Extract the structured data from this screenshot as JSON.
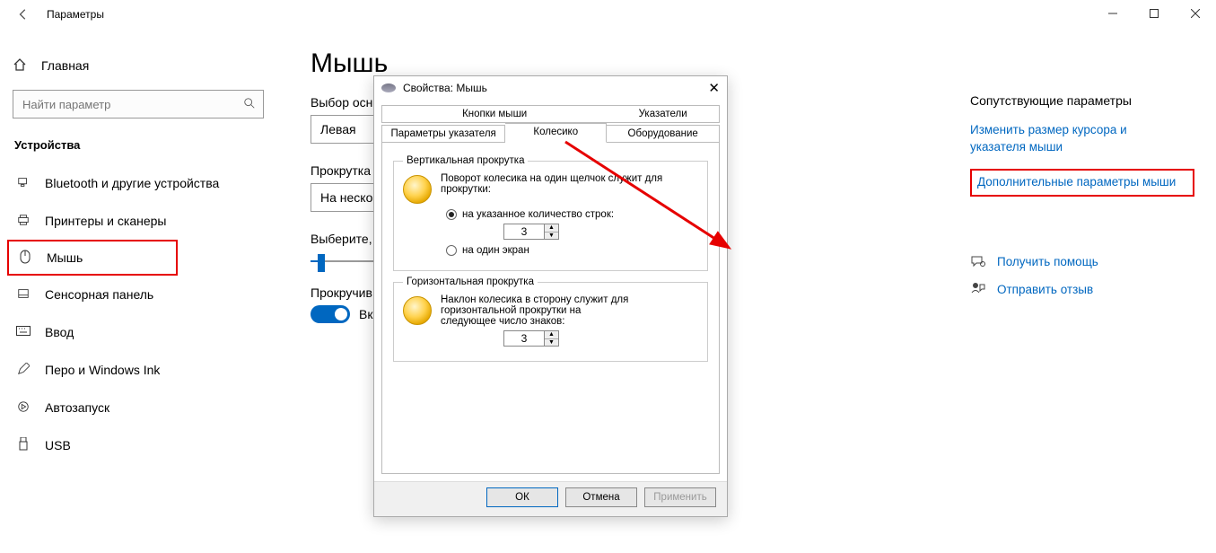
{
  "titlebar": {
    "title": "Параметры"
  },
  "sidebar": {
    "home": "Главная",
    "search_placeholder": "Найти параметр",
    "group": "Устройства",
    "items": [
      {
        "label": "Bluetooth и другие устройства"
      },
      {
        "label": "Принтеры и сканеры"
      },
      {
        "label": "Мышь"
      },
      {
        "label": "Сенсорная панель"
      },
      {
        "label": "Ввод"
      },
      {
        "label": "Перо и Windows Ink"
      },
      {
        "label": "Автозапуск"
      },
      {
        "label": "USB"
      }
    ]
  },
  "main": {
    "heading": "Мышь",
    "primary_button_label": "Выбор осн",
    "primary_button_value": "Левая",
    "scroll_label": "Прокрутка",
    "scroll_value": "На неско",
    "choose_label": "Выберите,",
    "inactive_label": "Прокручив",
    "inactive_toggle_text": "Вк"
  },
  "related": {
    "heading": "Сопутствующие параметры",
    "link1a": "Изменить размер курсора и",
    "link1b": "указателя мыши",
    "link2": "Дополнительные параметры мыши",
    "help": "Получить помощь",
    "feedback": "Отправить отзыв"
  },
  "dialog": {
    "title": "Свойства: Мышь",
    "tabs_row1": [
      "Кнопки мыши",
      "",
      "Указатели"
    ],
    "tabs_row2": [
      "Параметры указателя",
      "Колесико",
      "Оборудование"
    ],
    "vscroll": {
      "legend": "Вертикальная прокрутка",
      "desc": "Поворот колесика на один щелчок служит для прокрутки:",
      "opt1": "на указанное количество строк:",
      "value": "3",
      "opt2": "на один экран"
    },
    "hscroll": {
      "legend": "Горизонтальная прокрутка",
      "desc": "Наклон колесика в сторону служит для горизонтальной прокрутки на следующее число знаков:",
      "value": "3"
    },
    "buttons": {
      "ok": "ОК",
      "cancel": "Отмена",
      "apply": "Применить"
    }
  }
}
